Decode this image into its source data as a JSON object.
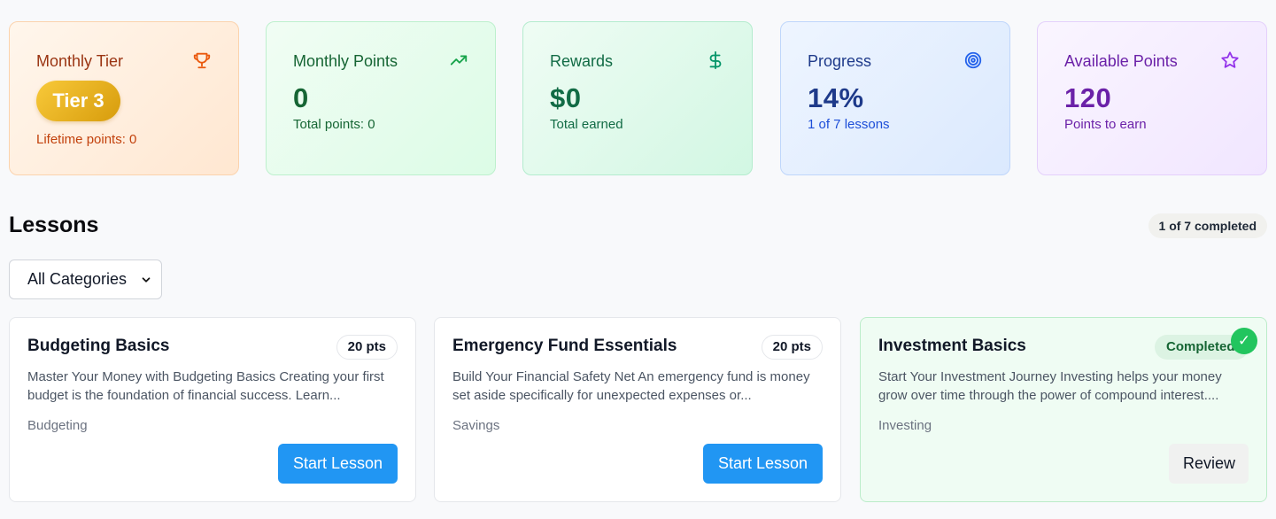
{
  "stats": {
    "tier": {
      "title": "Monthly Tier",
      "badge": "Tier 3",
      "sub": "Lifetime points: 0",
      "icon": "trophy-icon"
    },
    "monthly_points": {
      "title": "Monthly Points",
      "value": "0",
      "sub": "Total points: 0",
      "icon": "trending-up-icon"
    },
    "rewards": {
      "title": "Rewards",
      "value": "$0",
      "sub": "Total earned",
      "icon": "dollar-icon"
    },
    "progress": {
      "title": "Progress",
      "value": "14%",
      "sub": "1 of 7 lessons",
      "icon": "target-icon"
    },
    "available": {
      "title": "Available Points",
      "value": "120",
      "sub": "Points to earn",
      "icon": "star-icon"
    }
  },
  "lessons": {
    "title": "Lessons",
    "completed_summary": "1 of 7 completed",
    "category_filter": {
      "selected": "All Categories"
    },
    "items": [
      {
        "title": "Budgeting Basics",
        "points": "20 pts",
        "description": "Master Your Money with Budgeting Basics Creating your first budget is the foundation of financial success. Learn...",
        "category": "Budgeting",
        "action": "Start Lesson"
      },
      {
        "title": "Emergency Fund Essentials",
        "points": "20 pts",
        "description": "Build Your Financial Safety Net An emergency fund is money set aside specifically for unexpected expenses or...",
        "category": "Savings",
        "action": "Start Lesson"
      },
      {
        "title": "Investment Basics",
        "status": "Completed",
        "check": "✓",
        "description": "Start Your Investment Journey Investing helps your money grow over time through the power of compound interest....",
        "category": "Investing",
        "action": "Review"
      }
    ]
  },
  "colors": {
    "primary_button": "#2196f3",
    "completed_green": "#22c55e",
    "tier_gold": "#e4a912"
  }
}
